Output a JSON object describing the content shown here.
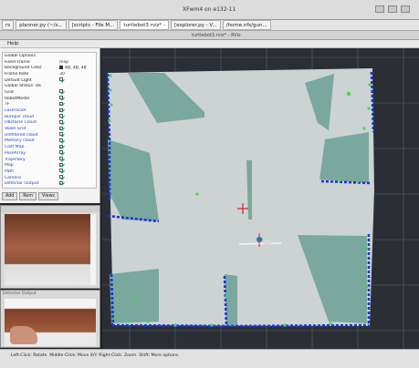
{
  "xfwm": {
    "title": "XFwm4 on e132-11"
  },
  "taskbar": {
    "tabs": [
      "rs",
      "planner.py (~/s...",
      "[scripts - File M...",
      "turtlebot3.rviz* -",
      "[explorer.py - V...",
      "/home.nfs/gun..."
    ]
  },
  "rviz": {
    "window_title": "turtlebot3.rviz* - RViz"
  },
  "menu": {
    "label": "Help"
  },
  "displays": {
    "rows": [
      {
        "label": "Global Options",
        "value": "",
        "blue": false,
        "check": "none"
      },
      {
        "label": "Fixed Frame",
        "value": "map",
        "blue": false,
        "check": "none"
      },
      {
        "label": "Background Color",
        "value": "48; 48; 48",
        "blue": false,
        "check": "swatch"
      },
      {
        "label": "Frame Rate",
        "value": "30",
        "blue": false,
        "check": "none"
      },
      {
        "label": "Default Light",
        "value": "",
        "blue": false,
        "check": "on"
      },
      {
        "label": "Global Status: Ok",
        "value": "",
        "blue": false,
        "check": "none"
      },
      {
        "label": "Grid",
        "value": "",
        "blue": false,
        "check": "on"
      },
      {
        "label": "RobotModel",
        "value": "",
        "blue": false,
        "check": "on"
      },
      {
        "label": "TF",
        "value": "",
        "blue": false,
        "check": "on"
      },
      {
        "label": "LaserScan",
        "value": "",
        "blue": true,
        "check": "on"
      },
      {
        "label": "Bumper cloud",
        "value": "",
        "blue": true,
        "check": "on"
      },
      {
        "label": "Obstacle Cloud",
        "value": "",
        "blue": true,
        "check": "on"
      },
      {
        "label": "Voxel Grid",
        "value": "",
        "blue": true,
        "check": "on"
      },
      {
        "label": "Unfiltered cloud",
        "value": "",
        "blue": true,
        "check": "on"
      },
      {
        "label": "Memory cloud",
        "value": "",
        "blue": true,
        "check": "on"
      },
      {
        "label": "Cost Map",
        "value": "",
        "blue": true,
        "check": "on"
      },
      {
        "label": "PoseArray",
        "value": "",
        "blue": true,
        "check": "on"
      },
      {
        "label": "Trajectory",
        "value": "",
        "blue": true,
        "check": "on"
      },
      {
        "label": "Map",
        "value": "",
        "blue": true,
        "check": "on"
      },
      {
        "label": "Path",
        "value": "",
        "blue": true,
        "check": "on"
      },
      {
        "label": "Camera",
        "value": "",
        "blue": true,
        "check": "on"
      },
      {
        "label": "Detector Output",
        "value": "",
        "blue": true,
        "check": "on"
      }
    ],
    "buttons": [
      "Add",
      "Rem",
      "Views"
    ]
  },
  "camera2": {
    "title": "Detector Output"
  },
  "status": {
    "text": "Left-Click: Rotate.  Middle-Click: Move X/Y.  Right-Click: Zoom.  Shift: More options."
  },
  "colors": {
    "map_free": "#cdd3d2",
    "map_unknown": "#7aa89e",
    "obstacle_blue": "#1837d6",
    "obstacle_green": "#42d84a",
    "background": "#2b2f35"
  }
}
